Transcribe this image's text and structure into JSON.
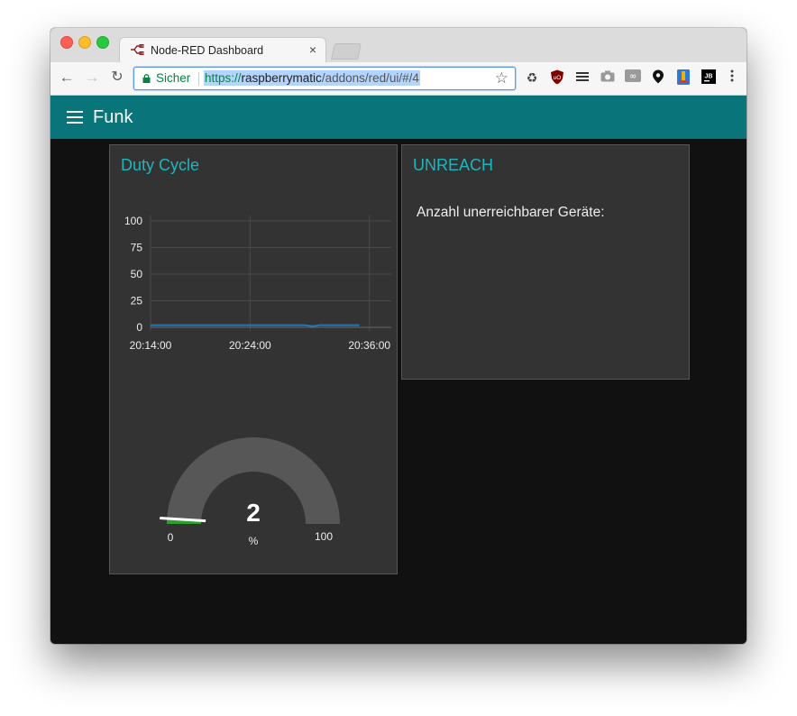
{
  "browser": {
    "tab_title": "Node-RED Dashboard",
    "tab_close": "×",
    "secure_label": "Sicher",
    "url_scheme": "https://",
    "url_host": "raspberrymatic",
    "url_path": "/addons/red/ui/#/4",
    "icons": [
      "back-arrow-icon",
      "forward-arrow-icon",
      "reload-icon",
      "lock-icon",
      "star-icon",
      "recycle-icon",
      "ublock-icon",
      "menu-lines-icon",
      "camera-icon",
      "infinity-icon",
      "pin-icon",
      "bookmark-icon",
      "jb-icon",
      "more-vert-icon"
    ]
  },
  "app": {
    "title": "Funk"
  },
  "cards": {
    "duty_cycle_title": "Duty Cycle",
    "unreach_title": "UNREACH",
    "unreach_text": "Anzahl unerreichbarer Geräte:"
  },
  "gauge": {
    "value": 2,
    "value_label": "2",
    "unit": "%",
    "min": 0,
    "max": 100,
    "min_label": "0",
    "max_label": "100",
    "fill_color": "#2ca02c",
    "track_color": "#575757"
  },
  "colors": {
    "accent": "#097479",
    "title_teal": "#1bb7be",
    "line_blue": "#1f77b4"
  },
  "chart_data": {
    "type": "line",
    "title": "",
    "xlabel": "",
    "ylabel": "",
    "ylim": [
      0,
      100
    ],
    "yticks": [
      0,
      25,
      50,
      75,
      100
    ],
    "xtick_labels": [
      "20:14:00",
      "20:24:00",
      "20:36:00"
    ],
    "xtick_minutes": [
      0,
      10,
      22
    ],
    "xlim_minutes": [
      0,
      24.2
    ],
    "grid": true,
    "series": [
      {
        "color": "#1f77b4",
        "points": [
          [
            0,
            2
          ],
          [
            2,
            2
          ],
          [
            4,
            2
          ],
          [
            6,
            2
          ],
          [
            8,
            2
          ],
          [
            10,
            2
          ],
          [
            12,
            2
          ],
          [
            14,
            2
          ],
          [
            15.5,
            2
          ],
          [
            16.3,
            1
          ],
          [
            17,
            2
          ],
          [
            18,
            2
          ],
          [
            19.5,
            2
          ],
          [
            21,
            2
          ]
        ]
      }
    ]
  }
}
